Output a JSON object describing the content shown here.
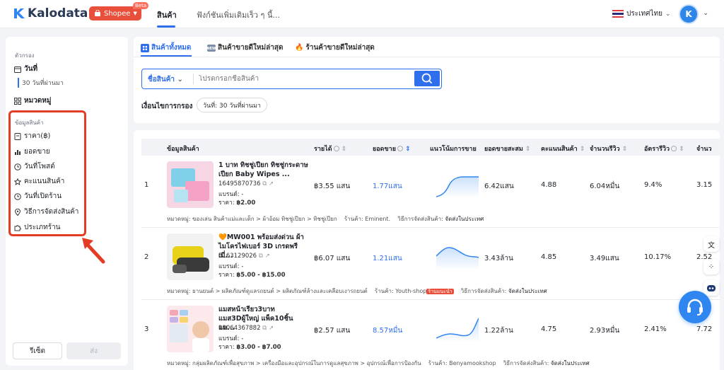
{
  "header": {
    "brand": "Kalodata",
    "platform": "Shopee",
    "platform_badge": "Beta",
    "nav_active": "สินค้า",
    "nav_search_placeholder": "ฟังก์ชันเพิ่มเติมเร็ว ๆ นี้...",
    "country": "ประเทศไทย",
    "avatar_initial": "K"
  },
  "sidebar": {
    "filter_title": "ตัวกรอง",
    "date_label": "วันที่",
    "date_value": "30 วันที่ผ่านมา",
    "category_label": "หมวดหมู่",
    "product_info_title": "ข้อมูลสินค้า",
    "items": [
      {
        "label": "ราคา(฿)",
        "icon": "price-tag-icon"
      },
      {
        "label": "ยอดขาย",
        "icon": "bar-chart-icon"
      },
      {
        "label": "วันที่โพสต์",
        "icon": "clock-icon"
      },
      {
        "label": "คะแนนสินค้า",
        "icon": "star-icon"
      },
      {
        "label": "วันที่เปิดร้าน",
        "icon": "clock-icon"
      },
      {
        "label": "วิธีการจัดส่งสินค้า",
        "icon": "location-pin-icon"
      },
      {
        "label": "ประเภทร้าน",
        "icon": "puzzle-icon"
      }
    ],
    "reset_label": "รีเซ็ต",
    "submit_label": "ส่ง"
  },
  "tabs": [
    {
      "label": "สินค้าทั้งหมด",
      "icon": "grid-icon"
    },
    {
      "label": "สินค้าขายดีใหม่ล่าสุด",
      "icon": "new-badge-icon"
    },
    {
      "label": "ร้านค้าขายดีใหม่ล่าสุด",
      "icon": "fire-icon"
    }
  ],
  "search": {
    "category": "ชื่อสินค้า",
    "placeholder": "โปรดกรอกชื่อสินค้า"
  },
  "conditions": {
    "label": "เงื่อนไขการกรอง",
    "chip": "วันที่: 30 วันที่ผ่านมา"
  },
  "table": {
    "columns": [
      "ข้อมูลสินค้า",
      "รายได้",
      "ยอดขาย",
      "แนวโน้มการขาย",
      "ยอดขายสะสม",
      "คะแนนสินค้า",
      "จำนวนรีวิว",
      "อัตรารีวิว",
      "จำนว"
    ],
    "rows": [
      {
        "rank": "1",
        "name": "1 บาท ทิชชู่เปียก ทิชชู่กระดาษเปียก Baby Wipes ...",
        "id": "16495870736",
        "brand": "แบรนด์: -",
        "price_label": "ราคา:",
        "price": "฿2.00",
        "revenue": "฿3.55 แสน",
        "sales": "1.77แสน",
        "cumulative": "6.42แสน",
        "rating": "4.88",
        "reviews": "6.04หมื่น",
        "review_rate": "9.4%",
        "extra": "3.15",
        "category": "หมวดหมู่: ของเล่น สินค้าแม่และเด็ก > ผ้าอ้อม ทิชชู่เปียก > ทิชชู่เปียก",
        "shop": "ร้านค้า: Eminent.",
        "shipping_label": "วิธีการจัดส่งสินค้า:",
        "shipping": "จัดส่งในประเทศ",
        "badge": ""
      },
      {
        "rank": "2",
        "name": "🧡MW001 พร้อมส่งด่วน ผ้าไมโครไฟเบอร์ 3D เกรดพรีเมี่...",
        "id": "5163129026",
        "brand": "แบรนด์: -",
        "price_label": "ราคา:",
        "price": "฿5.00 - ฿15.00",
        "revenue": "฿6.07 แสน",
        "sales": "1.21แสน",
        "cumulative": "3.43ล้าน",
        "rating": "4.85",
        "reviews": "3.49แสน",
        "review_rate": "10.17%",
        "extra": "2.52",
        "category": "หมวดหมู่: ยานยนต์ > ผลิตภัณฑ์ดูแลรถยนต์ > ผลิตภัณฑ์ล้างและเคลือบเงารถยนต์",
        "shop": "ร้านค้า: Youth-shop",
        "shipping_label": "วิธีการจัดส่งสินค้า:",
        "shipping": "จัดส่งในประเทศ",
        "badge": "ร้านแนะนำ"
      },
      {
        "rank": "3",
        "name": "แมสหน้าเรียว3บาท แมส3Dผู้ใหญ่ แพ็ค10ชิ้น แม...",
        "id": "10064367882",
        "brand": "แบรนด์: -",
        "price_label": "ราคา:",
        "price": "฿3.00 - ฿7.00",
        "revenue": "฿2.57 แสน",
        "sales": "8.57หมื่น",
        "cumulative": "1.22ล้าน",
        "rating": "4.75",
        "reviews": "2.93หมื่น",
        "review_rate": "2.41%",
        "extra": "7.72",
        "category": "หมวดหมู่: กลุ่มผลิตภัณฑ์เพื่อสุขภาพ > เครื่องมือและอุปกรณ์ในการดูแลสุขภาพ > อุปกรณ์เพื่อการป้องกัน",
        "shop": "ร้านค้า: Benyamookshop",
        "shipping_label": "วิธีการจัดส่งสินค้า:",
        "shipping": "จัดส่งในประเทศ",
        "badge": ""
      }
    ]
  },
  "floating": {
    "buttons": [
      "translate-icon",
      "apps-icon",
      "robot-icon"
    ],
    "support": "headset-icon"
  },
  "colors": {
    "accent": "#2f6fed",
    "highlight": "#e43c24",
    "platform": "#e9503b"
  }
}
